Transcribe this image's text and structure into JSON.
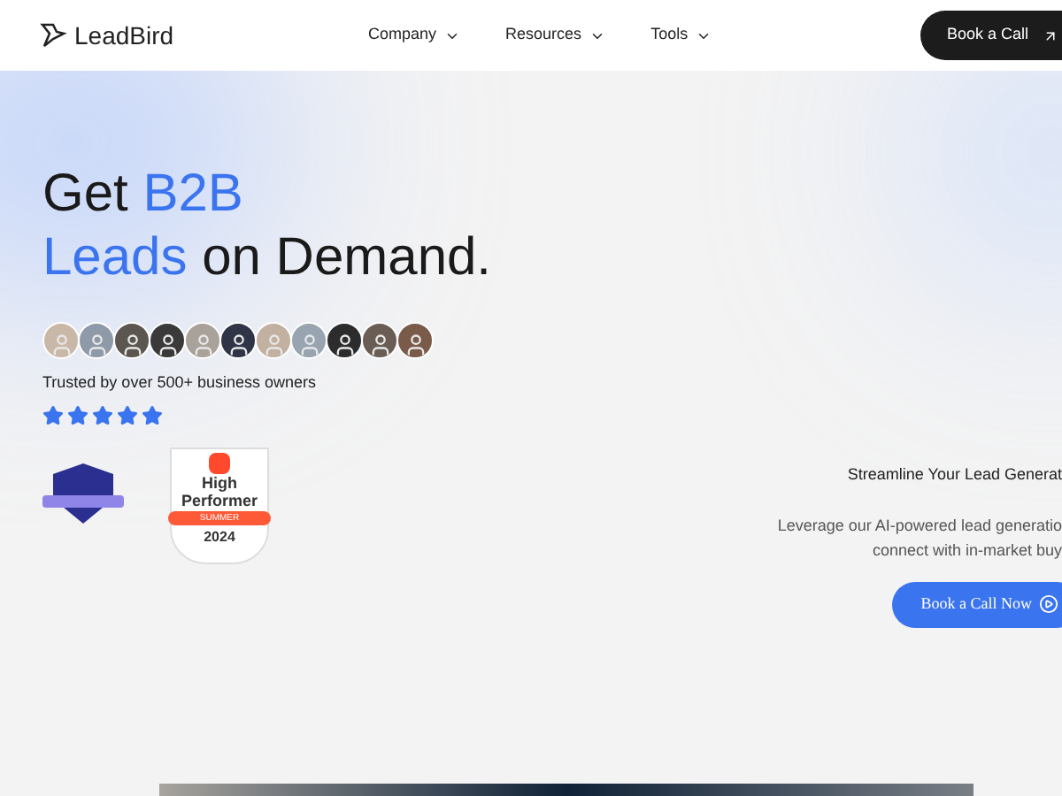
{
  "header": {
    "logo": "LeadBird",
    "nav": [
      {
        "label": "Company"
      },
      {
        "label": "Resources"
      },
      {
        "label": "Tools"
      }
    ],
    "cta": "Book a Call"
  },
  "hero": {
    "headline_lines": [
      [
        {
          "text": "Get ",
          "highlight": false
        },
        {
          "text": "B2B",
          "highlight": true
        }
      ],
      [
        {
          "text": "Leads",
          "highlight": true
        },
        {
          "text": " on Demand.",
          "highlight": false
        }
      ]
    ],
    "trust_text": "Trusted by over 500+ business owners",
    "stars": 5,
    "g2_badge": {
      "line1": "High",
      "line2": "Performer",
      "ribbon": "SUMMER",
      "year": "2024"
    }
  },
  "side": {
    "title": "Streamline Your Lead Generat",
    "body_lines": [
      "Leverage our AI-powered lead generatio",
      "connect with in-market buy"
    ],
    "cta": "Book a Call Now"
  }
}
